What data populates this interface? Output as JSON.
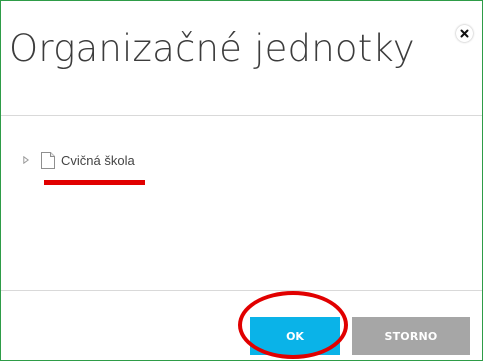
{
  "dialog": {
    "title": "Organizačné jednotky",
    "close_icon": "close-icon",
    "border_color": "#2e9c48"
  },
  "tree": {
    "items": [
      {
        "label": "Cvičná škola",
        "icon": "document-icon",
        "expander_icon": "triangle-right-icon",
        "expanded": false
      }
    ]
  },
  "annotations": {
    "color": "#e10000"
  },
  "footer": {
    "ok_label": "OK",
    "cancel_label": "STORNO",
    "ok_color": "#0ab3e8",
    "cancel_color": "#a6a6a6"
  }
}
